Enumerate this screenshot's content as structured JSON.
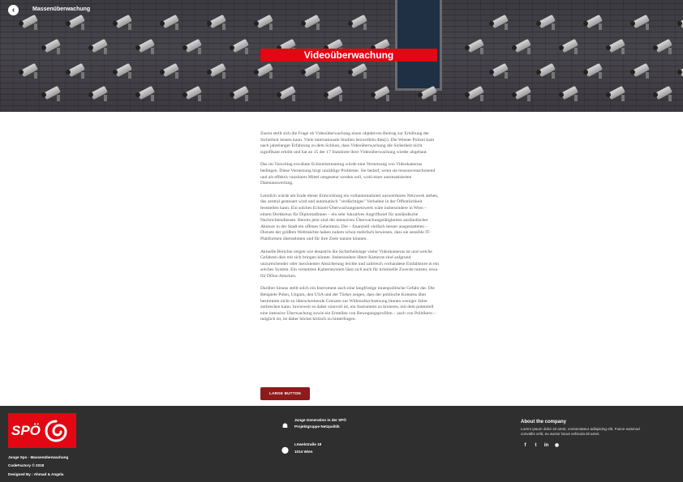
{
  "header": {
    "back_icon": "arrow-left-icon",
    "title": "Massenüberwachung",
    "hero_title": "Videoüberwachung"
  },
  "article": {
    "paragraphs": [
      "Zuerst stellt sich die Frage ob Videoüberwachung einen objektiven Beitrag zur Erhöhung der Sicherheit leisten kann. Viele internationale Studien bezweifeln dies(i). Die Wiener Polizei kam nach jahrelanger Erfahrung zu dem Schluss, dass Videoüberwachung die Sicherheit nicht signifikant erhöht und hat an 15 der 17 Standorte ihrer Videoüberwachung wieder abgebaut.",
      "Das im Vorschlag erwähnte Echtzeitstreaming würde eine Vernetzung von Videokameras bedingen. Diese Vernetzung birgt unzählige Probleme. Sie bedarf, wenn sie ressourcenschonend und als effektiv nutzbares Mittel umgesetzt werden soll, wohl einer automatisierten Datenauswertung.",
      "Letztlich würde am Ende dieser Entwicklung ein vollautomatisiert auswertbares Netzwerk stehen, das zentral gesteuert wird und automatisch \"verdächtiges\" Verhalten in der Öffentlichkeit feststellen kann. Ein solches Echtzeit-Überwachungsnetzwerk wäre insbesondere in Wien – einem Drehkreuz für DiplomatInnen – ein sehr lukratives Angriffsziel für ausländische Nachrichtendienste. Bereits jetzt sind die intensiven Überwachungstätigkeiten ausländischer Akteure in der Stadt ein offenes Geheimnis. Die – finanziell vielfach besser ausgestatteten – Dienste der größten Weltmächte haben zudem schon mehrfach bewiesen, dass sie sensible IT-Plattformen übernehmen und für ihre Ziele nutzen können.",
      "Aktuelle Berichte zeigen wie desaströs die Sicherheitslage vieler Videokameras ist und welche Gefahren dies mit sich bringen könnte. Insbesondere ältere Kameras sind aufgrund unzureichender oder inexistenter Absicherung leichte und zahlreich vorhandene Einfallstore in ein solches System. Ein vernetztes Kamerasystem lässt sich auch für kriminelle Zwecke nutzen, etwa für DDos-Attacken.",
      "Darüber hinaus stellt solch ein Instrument auch eine langfristige innenpolitische Gefahr dar. Die Beispiele Polen, Ungarn, den USA und der Türkei zeigen, dass der politische Konsens über bestimmte nicht zu überschreitende Grenzen zur Willensdurchsetzung binnen weniger Jahre zerbrechen kann. Inwieweit es daher sinnvoll ist, ein Instrument zu kreieren, mit dem potentiell eine intensive Überwachung sowie ein Erstellen von Bewegungsprofilen – auch von Politikern – möglich ist, ist daher höchst kritisch zu hinterfragen."
    ],
    "button_label": "LARGE BUTTON"
  },
  "footer": {
    "logo_text": "SPÖ",
    "logo_icon": "spo-swirl-icon",
    "site_line": "Junge Spo · Massenüberwachung",
    "copyright": "CodeFactory © 2018",
    "designed_by": "Designed By : Ahmad & Angela",
    "org_icon": "group-icon",
    "org_line1": "Junge Generation in der SPÖ",
    "org_line2": "Projektgruppe Netzpolitik",
    "address_icon": "location-pin-icon",
    "address_line1": "Löwelstraße 18",
    "address_line2": "1014 Wien",
    "about_title": "About the company",
    "about_text": "Lorem ipsum dolor sit amet, consectateur adispicing elit. Fusce euismod convallis velit, eu auctor lacus vehicula sit amet.",
    "social": [
      {
        "icon": "facebook-icon",
        "glyph": "f"
      },
      {
        "icon": "twitter-icon",
        "glyph": "t"
      },
      {
        "icon": "linkedin-icon",
        "glyph": "in"
      },
      {
        "icon": "github-icon",
        "glyph": "◉"
      }
    ]
  }
}
